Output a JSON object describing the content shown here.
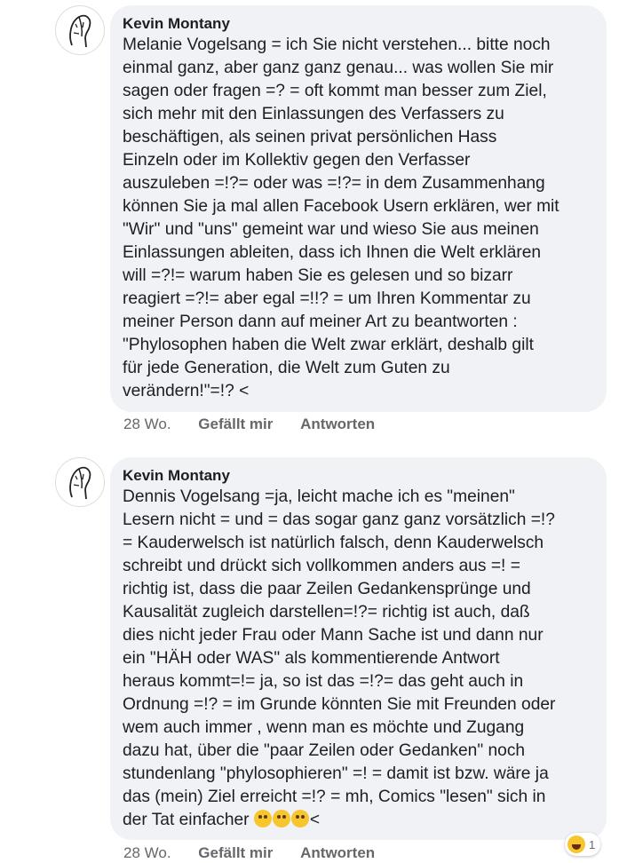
{
  "comments": [
    {
      "author": "Kevin Montany",
      "lines": [
        "Melanie Vogelsang = ich Sie nicht verstehen... bitte noch",
        "einmal ganz, aber ganz ganz genau... was wollen Sie mir",
        "sagen oder fragen =? = oft kommt man besser zum Ziel,",
        "sich mehr mit den Einlassungen des Verfassers zu",
        "beschäftigen, als seinen privat persönlichen Hass",
        "Einzeln oder im Kollektiv gegen den Verfasser",
        "auszuleben =!?= oder was =!?= in dem Zusammenhang",
        "können Sie ja mal allen Facebook Usern erklären, wer mit",
        "\"Wir\" und \"uns\" gemeint war und wieso Sie aus meinen",
        "Einlassungen ableiten, dass ich Ihnen die Welt erklären",
        "will =?!= warum haben Sie  es  gelesen und so bizarr",
        "reagiert =?!= aber egal =!!? = um Ihren Kommentar zu",
        "meiner Person dann auf meiner Art zu beantworten :",
        "\"Phylosophen haben die Welt zwar erklärt, deshalb gilt",
        "für jede Generation, die Welt zum Guten zu",
        "verändern!\"=!? <"
      ],
      "time": "28 Wo.",
      "like_label": "Gefällt mir",
      "reply_label": "Antworten"
    },
    {
      "author": "Kevin Montany",
      "lines": [
        "Dennis Vogelsang =ja, leicht mache ich es \"meinen\"",
        "Lesern nicht = und = das sogar ganz ganz vorsätzlich =!?",
        "= Kauderwelsch ist natürlich falsch, denn Kauderwelsch",
        "schreibt und drückt sich  vollkommen anders aus  =! =",
        "richtig ist, dass die paar Zeilen  Gedankensprünge und",
        "Kausalität zugleich darstellen=!?= richtig ist auch, daß",
        "dies nicht jeder Frau oder Mann Sache ist und dann nur",
        "ein \"HÄH oder WAS\" als kommentierende Antwort",
        "heraus kommt=!= ja, so ist das =!?= das geht auch in",
        "Ordnung =!? = im Grunde könnten Sie mit Freunden oder",
        "wem auch immer , wenn man es möchte und Zugang",
        "dazu hat, über die \"paar Zeilen oder Gedanken\" noch",
        "stundenlang \"phylosophieren\" =! = damit ist bzw. wäre ja",
        "das (mein) Ziel erreicht =!? = mh, Comics \"lesen\" sich  in",
        "der Tat einfacher"
      ],
      "last_line_suffix": "<",
      "emojis": [
        "thinking-face-emoji",
        "flushed-face-emoji",
        "smirking-face-emoji"
      ],
      "time": "28 Wo.",
      "like_label": "Gefällt mir",
      "reply_label": "Antworten",
      "reaction": {
        "icon": "laughing-face-icon",
        "count": "1"
      }
    }
  ]
}
